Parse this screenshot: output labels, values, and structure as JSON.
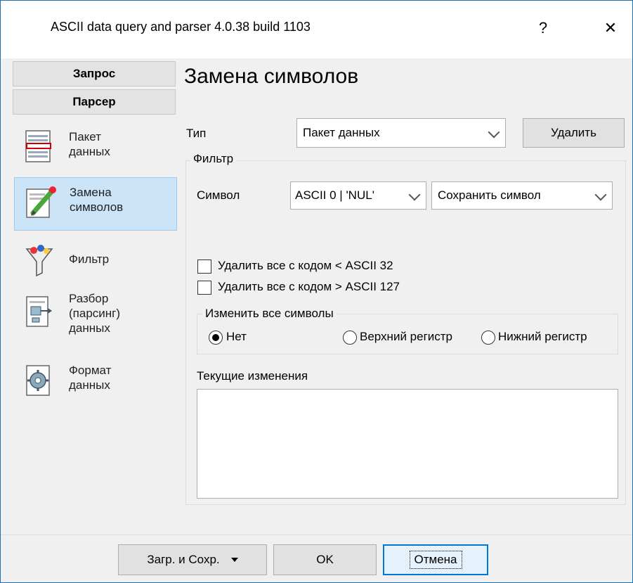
{
  "window": {
    "title": "ASCII data query and parser 4.0.38 build 1103",
    "help_label": "?",
    "close_label": "✕"
  },
  "sidebar": {
    "headers": [
      "Запрос",
      "Парсер"
    ],
    "items": [
      {
        "label": "Пакет\nданных",
        "icon": "data-packet-icon"
      },
      {
        "label": "Замена\nсимволов",
        "icon": "replace-characters-icon",
        "selected": true
      },
      {
        "label": "Фильтр",
        "icon": "filter-funnel-icon"
      },
      {
        "label": "Разбор\n(парсинг)\nданных",
        "icon": "parsing-icon"
      },
      {
        "label": "Формат\nданных",
        "icon": "gear-icon"
      }
    ]
  },
  "main": {
    "title": "Замена символов",
    "type_label": "Тип",
    "type_value": "Пакет данных",
    "delete_label": "Удалить",
    "filter_group": "Фильтр",
    "symbol_label": "Символ",
    "symbol_value": "ASCII 0 | 'NUL'",
    "action_value": "Сохранить символ",
    "remove_below": "Удалить все с кодом < ASCII 32",
    "remove_above": "Удалить все с кодом > ASCII 127",
    "case_group": "Изменить все символы",
    "case_none": "Нет",
    "case_upper": "Верхний регистр",
    "case_lower": "Нижний регистр",
    "current_changes": "Текущие изменения"
  },
  "footer": {
    "load_save_label": "Загр. и Сохр.",
    "ok_label": "OK",
    "cancel_label": "Отмена"
  }
}
